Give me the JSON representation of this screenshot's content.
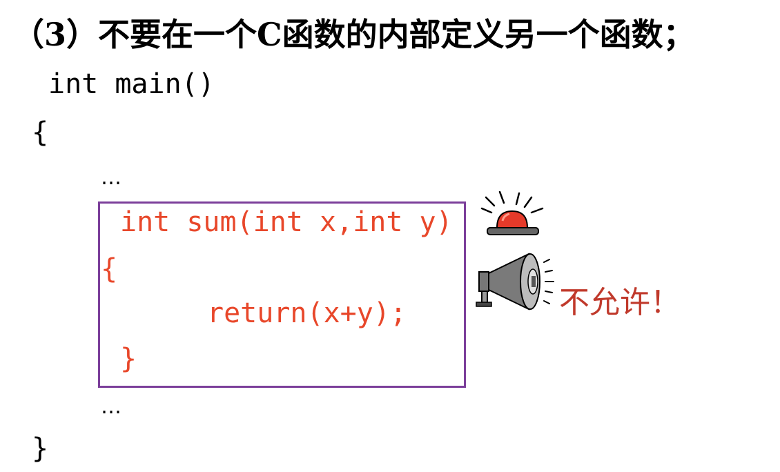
{
  "heading": "（3）不要在一个C函数的内部定义另一个函数；",
  "code": {
    "main_signature": "int main()",
    "open_brace": "{",
    "ellipsis_top": "…",
    "inner_signature": "int sum(int x,int y)",
    "inner_open_brace": "{",
    "inner_return": "return(x+y);",
    "inner_close_brace": "}",
    "ellipsis_bottom": "…",
    "close_brace": "}"
  },
  "warning_text": "不允许！",
  "icons": {
    "alarm": "alarm-light-icon",
    "megaphone": "megaphone-icon"
  },
  "colors": {
    "highlight_code": "#e8472a",
    "box_border": "#7b3e9a",
    "warning_text": "#c0392b",
    "alarm_red": "#e53a2a"
  }
}
